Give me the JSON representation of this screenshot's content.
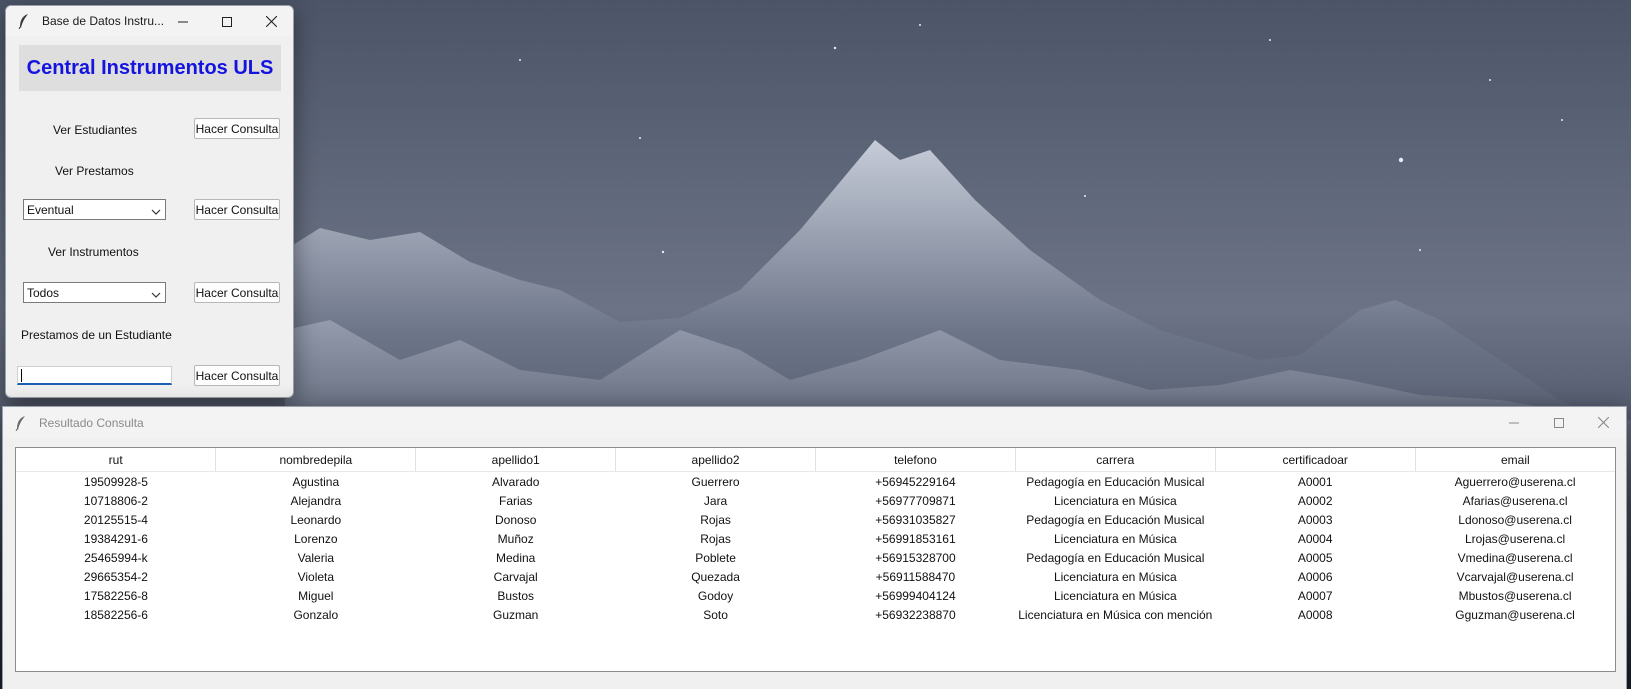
{
  "main_window": {
    "title": "Base de Datos Instru...",
    "header": "Central Instrumentos ULS",
    "sections": {
      "ver_estudiantes_label": "Ver Estudiantes",
      "ver_prestamos_label": "Ver Prestamos",
      "ver_instrumentos_label": "Ver Instrumentos",
      "prestamos_estudiante_label": "Prestamos de un Estudiante"
    },
    "prestamos_combo_value": "Eventual",
    "instrumentos_combo_value": "Todos",
    "estudiante_input_value": "",
    "query_button_label": "Hacer Consulta"
  },
  "result_window": {
    "title": "Resultado Consulta",
    "columns": [
      "rut",
      "nombredepila",
      "apellido1",
      "apellido2",
      "telefono",
      "carrera",
      "certificadoar",
      "email"
    ],
    "rows": [
      [
        "19509928-5",
        "Agustina",
        "Alvarado",
        "Guerrero",
        "+56945229164",
        "Pedagogía en Educación Musical",
        "A0001",
        "Aguerrero@userena.cl"
      ],
      [
        "10718806-2",
        "Alejandra",
        "Farias",
        "Jara",
        "+56977709871",
        "Licenciatura en Música",
        "A0002",
        "Afarias@userena.cl"
      ],
      [
        "20125515-4",
        "Leonardo",
        "Donoso",
        "Rojas",
        "+56931035827",
        "Pedagogía en Educación Musical",
        "A0003",
        "Ldonoso@userena.cl"
      ],
      [
        "19384291-6",
        "Lorenzo",
        "Muñoz",
        "Rojas",
        "+56991853161",
        "Licenciatura en Música",
        "A0004",
        "Lrojas@userena.cl"
      ],
      [
        "25465994-k",
        "Valeria",
        "Medina",
        "Poblete",
        "+56915328700",
        "Pedagogía en Educación Musical",
        "A0005",
        "Vmedina@userena.cl"
      ],
      [
        "29665354-2",
        "Violeta",
        "Carvajal",
        "Quezada",
        "+56911588470",
        "Licenciatura en Música",
        "A0006",
        "Vcarvajal@userena.cl"
      ],
      [
        "17582256-8",
        "Miguel",
        "Bustos",
        "Godoy",
        "+56999404124",
        "Licenciatura en Música",
        "A0007",
        "Mbustos@userena.cl"
      ],
      [
        "18582256-6",
        "Gonzalo",
        "Guzman",
        "Soto",
        "+56932238870",
        "Licenciatura en Música con mención",
        "A0008",
        "Gguzman@userena.cl"
      ]
    ]
  },
  "icons": {
    "app_icon": "feather-icon",
    "minimize": "minimize-icon",
    "maximize": "maximize-icon",
    "close": "close-icon",
    "combo_arrow": "chevron-down-icon"
  },
  "colors": {
    "header_text": "#1414e0",
    "header_bg": "#dedede",
    "entry_focus": "#1a5fb4"
  }
}
